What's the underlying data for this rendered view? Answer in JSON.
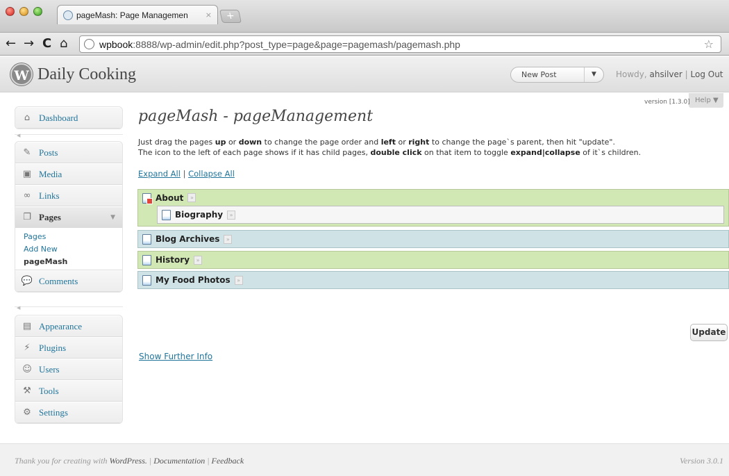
{
  "browser": {
    "tab_title": "pageMash: Page Managemen",
    "tab_close": "×",
    "new_tab": "+",
    "url_host": "wpbook",
    "url_rest": ":8888/wp-admin/edit.php?post_type=page&page=pagemash/pagemash.php",
    "star": "☆"
  },
  "header": {
    "site_title": "Daily Cooking",
    "new_post": "New Post",
    "howdy_prefix": "Howdy, ",
    "user": "ahsilver",
    "sep": " | ",
    "logout": "Log Out",
    "help": "Help ▼"
  },
  "sidebar": {
    "dashboard": "Dashboard",
    "posts": "Posts",
    "media": "Media",
    "links": "Links",
    "pages": "Pages",
    "pages_sub": [
      "Pages",
      "Add New",
      "pageMash"
    ],
    "comments": "Comments",
    "appearance": "Appearance",
    "plugins": "Plugins",
    "users": "Users",
    "tools": "Tools",
    "settings": "Settings"
  },
  "main": {
    "version": "version [1.3.0]",
    "title": "pageMash - pageManagement",
    "intro_line1": {
      "t1": "Just drag the pages ",
      "b1": "up",
      "t2": " or ",
      "b2": "down",
      "t3": " to change the page order and ",
      "b3": "left",
      "t4": " or ",
      "b4": "right",
      "t5": " to change the page`s parent, then hit \"update\"."
    },
    "intro_line2": {
      "t1": "The icon to the left of each page shows if it has child pages, ",
      "b1": "double click",
      "t2": " on that item to toggle ",
      "b2": "expand|collapse",
      "t3": " of it`s children."
    },
    "expand_all": "Expand All",
    "divider": " | ",
    "collapse_all": "Collapse All",
    "pages": [
      {
        "label": "About"
      },
      {
        "label": "Biography"
      },
      {
        "label": "Blog Archives"
      },
      {
        "label": "History"
      },
      {
        "label": "My Food Photos"
      }
    ],
    "update": "Update",
    "show_further": "Show Further Info"
  },
  "footer": {
    "thanks": "Thank you for creating with ",
    "wordpress": "WordPress.",
    "sep1": " | ",
    "documentation": "Documentation",
    "sep2": " | ",
    "feedback": "Feedback",
    "version": "Version 3.0.1"
  }
}
